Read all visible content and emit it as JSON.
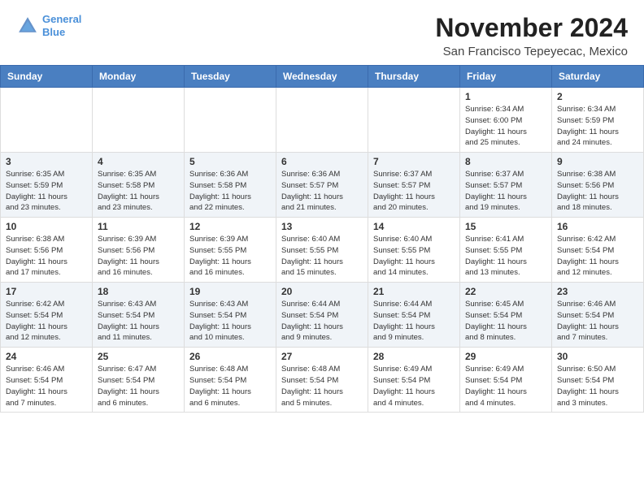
{
  "header": {
    "logo_line1": "General",
    "logo_line2": "Blue",
    "month": "November 2024",
    "location": "San Francisco Tepeyecac, Mexico"
  },
  "days_of_week": [
    "Sunday",
    "Monday",
    "Tuesday",
    "Wednesday",
    "Thursday",
    "Friday",
    "Saturday"
  ],
  "weeks": [
    [
      {
        "day": "",
        "info": ""
      },
      {
        "day": "",
        "info": ""
      },
      {
        "day": "",
        "info": ""
      },
      {
        "day": "",
        "info": ""
      },
      {
        "day": "",
        "info": ""
      },
      {
        "day": "1",
        "info": "Sunrise: 6:34 AM\nSunset: 6:00 PM\nDaylight: 11 hours\nand 25 minutes."
      },
      {
        "day": "2",
        "info": "Sunrise: 6:34 AM\nSunset: 5:59 PM\nDaylight: 11 hours\nand 24 minutes."
      }
    ],
    [
      {
        "day": "3",
        "info": "Sunrise: 6:35 AM\nSunset: 5:59 PM\nDaylight: 11 hours\nand 23 minutes."
      },
      {
        "day": "4",
        "info": "Sunrise: 6:35 AM\nSunset: 5:58 PM\nDaylight: 11 hours\nand 23 minutes."
      },
      {
        "day": "5",
        "info": "Sunrise: 6:36 AM\nSunset: 5:58 PM\nDaylight: 11 hours\nand 22 minutes."
      },
      {
        "day": "6",
        "info": "Sunrise: 6:36 AM\nSunset: 5:57 PM\nDaylight: 11 hours\nand 21 minutes."
      },
      {
        "day": "7",
        "info": "Sunrise: 6:37 AM\nSunset: 5:57 PM\nDaylight: 11 hours\nand 20 minutes."
      },
      {
        "day": "8",
        "info": "Sunrise: 6:37 AM\nSunset: 5:57 PM\nDaylight: 11 hours\nand 19 minutes."
      },
      {
        "day": "9",
        "info": "Sunrise: 6:38 AM\nSunset: 5:56 PM\nDaylight: 11 hours\nand 18 minutes."
      }
    ],
    [
      {
        "day": "10",
        "info": "Sunrise: 6:38 AM\nSunset: 5:56 PM\nDaylight: 11 hours\nand 17 minutes."
      },
      {
        "day": "11",
        "info": "Sunrise: 6:39 AM\nSunset: 5:56 PM\nDaylight: 11 hours\nand 16 minutes."
      },
      {
        "day": "12",
        "info": "Sunrise: 6:39 AM\nSunset: 5:55 PM\nDaylight: 11 hours\nand 16 minutes."
      },
      {
        "day": "13",
        "info": "Sunrise: 6:40 AM\nSunset: 5:55 PM\nDaylight: 11 hours\nand 15 minutes."
      },
      {
        "day": "14",
        "info": "Sunrise: 6:40 AM\nSunset: 5:55 PM\nDaylight: 11 hours\nand 14 minutes."
      },
      {
        "day": "15",
        "info": "Sunrise: 6:41 AM\nSunset: 5:55 PM\nDaylight: 11 hours\nand 13 minutes."
      },
      {
        "day": "16",
        "info": "Sunrise: 6:42 AM\nSunset: 5:54 PM\nDaylight: 11 hours\nand 12 minutes."
      }
    ],
    [
      {
        "day": "17",
        "info": "Sunrise: 6:42 AM\nSunset: 5:54 PM\nDaylight: 11 hours\nand 12 minutes."
      },
      {
        "day": "18",
        "info": "Sunrise: 6:43 AM\nSunset: 5:54 PM\nDaylight: 11 hours\nand 11 minutes."
      },
      {
        "day": "19",
        "info": "Sunrise: 6:43 AM\nSunset: 5:54 PM\nDaylight: 11 hours\nand 10 minutes."
      },
      {
        "day": "20",
        "info": "Sunrise: 6:44 AM\nSunset: 5:54 PM\nDaylight: 11 hours\nand 9 minutes."
      },
      {
        "day": "21",
        "info": "Sunrise: 6:44 AM\nSunset: 5:54 PM\nDaylight: 11 hours\nand 9 minutes."
      },
      {
        "day": "22",
        "info": "Sunrise: 6:45 AM\nSunset: 5:54 PM\nDaylight: 11 hours\nand 8 minutes."
      },
      {
        "day": "23",
        "info": "Sunrise: 6:46 AM\nSunset: 5:54 PM\nDaylight: 11 hours\nand 7 minutes."
      }
    ],
    [
      {
        "day": "24",
        "info": "Sunrise: 6:46 AM\nSunset: 5:54 PM\nDaylight: 11 hours\nand 7 minutes."
      },
      {
        "day": "25",
        "info": "Sunrise: 6:47 AM\nSunset: 5:54 PM\nDaylight: 11 hours\nand 6 minutes."
      },
      {
        "day": "26",
        "info": "Sunrise: 6:48 AM\nSunset: 5:54 PM\nDaylight: 11 hours\nand 6 minutes."
      },
      {
        "day": "27",
        "info": "Sunrise: 6:48 AM\nSunset: 5:54 PM\nDaylight: 11 hours\nand 5 minutes."
      },
      {
        "day": "28",
        "info": "Sunrise: 6:49 AM\nSunset: 5:54 PM\nDaylight: 11 hours\nand 4 minutes."
      },
      {
        "day": "29",
        "info": "Sunrise: 6:49 AM\nSunset: 5:54 PM\nDaylight: 11 hours\nand 4 minutes."
      },
      {
        "day": "30",
        "info": "Sunrise: 6:50 AM\nSunset: 5:54 PM\nDaylight: 11 hours\nand 3 minutes."
      }
    ]
  ]
}
